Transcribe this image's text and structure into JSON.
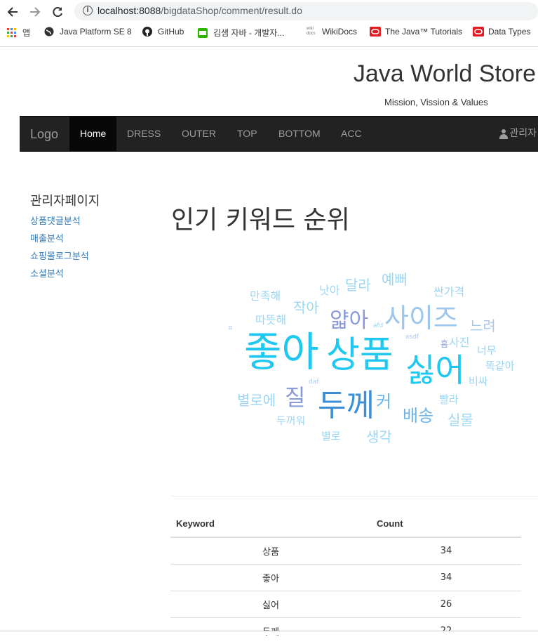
{
  "browser": {
    "url_host": "localhost:8088",
    "url_path": "/bigdataShop/comment/result.do",
    "bookmarks": [
      {
        "label": "앱",
        "icon": "apps-grid-icon"
      },
      {
        "label": "Java Platform SE 8",
        "icon": "globe-icon"
      },
      {
        "label": "GitHub",
        "icon": "github-icon"
      },
      {
        "label": "김샘 자바 - 개발자...",
        "icon": "blog-icon"
      },
      {
        "label": "WikiDocs",
        "icon": "wikidocs-icon"
      },
      {
        "label": "The Java™ Tutorials",
        "icon": "oracle-icon"
      },
      {
        "label": "Data Types",
        "icon": "oracle-icon"
      }
    ]
  },
  "header": {
    "brand": "Java World Store",
    "tagline": "Mission, Vission & Values"
  },
  "navbar": {
    "logo": "Logo",
    "items": [
      "Home",
      "DRESS",
      "OUTER",
      "TOP",
      "BOTTOM",
      "ACC"
    ],
    "active": "Home",
    "admin": "관리자"
  },
  "sidebar": {
    "title": "관리자페이지",
    "links": [
      "상품댓글분석",
      "매출분석",
      "쇼핑몰로그분석",
      "소셜분석"
    ]
  },
  "main": {
    "title": "인기 키워드 순위"
  },
  "wordcloud": [
    {
      "text": "좋아",
      "color": "#1ec8f0"
    },
    {
      "text": "상품",
      "color": "#1ec8f0"
    },
    {
      "text": "싫어",
      "color": "#1ec8f0"
    },
    {
      "text": "두께",
      "color": "#3a8fd6"
    },
    {
      "text": "사이즈",
      "color": "#9cc6ec"
    },
    {
      "text": "얇아",
      "color": "#8a9ad8"
    },
    {
      "text": "질",
      "color": "#8a9ad8"
    },
    {
      "text": "배송",
      "color": "#6fb4e8"
    },
    {
      "text": "커",
      "color": "#6fb4e8"
    },
    {
      "text": "실물",
      "color": "#9cd6f2"
    },
    {
      "text": "느려",
      "color": "#a8c8ec"
    },
    {
      "text": "별로에",
      "color": "#9cd6f2"
    },
    {
      "text": "생각",
      "color": "#9cd6f2"
    },
    {
      "text": "달라",
      "color": "#9cd6f2"
    },
    {
      "text": "예뻐",
      "color": "#9cd6f2"
    },
    {
      "text": "작아",
      "color": "#9cd6f2"
    },
    {
      "text": "만족해",
      "color": "#9cd6f2"
    },
    {
      "text": "낫아",
      "color": "#9cd6f2"
    },
    {
      "text": "싼가격",
      "color": "#9cd6f2"
    },
    {
      "text": "따뜻해",
      "color": "#9cd6f2"
    },
    {
      "text": "사진",
      "color": "#9cd6f2"
    },
    {
      "text": "너무",
      "color": "#9cd6f2"
    },
    {
      "text": "똑같아",
      "color": "#9cd6f2"
    },
    {
      "text": "비싸",
      "color": "#9cd6f2"
    },
    {
      "text": "빨라",
      "color": "#9cd6f2"
    },
    {
      "text": "두꺼워",
      "color": "#9cd6f2"
    },
    {
      "text": "별로",
      "color": "#9cd6f2"
    },
    {
      "text": "afd",
      "color": "#9cd6f2"
    },
    {
      "text": "asdf",
      "color": "#b0c8ec"
    },
    {
      "text": "daf",
      "color": "#b0c8ec"
    },
    {
      "text": "흠",
      "color": "#8a9ad8"
    },
    {
      "text": "ㅍ",
      "color": "#b0c8ec"
    }
  ],
  "table": {
    "headers": [
      "Keyword",
      "Count"
    ],
    "rows": [
      [
        "상품",
        "34"
      ],
      [
        "좋아",
        "34"
      ],
      [
        "싫어",
        "26"
      ],
      [
        "두께",
        "22"
      ]
    ]
  }
}
